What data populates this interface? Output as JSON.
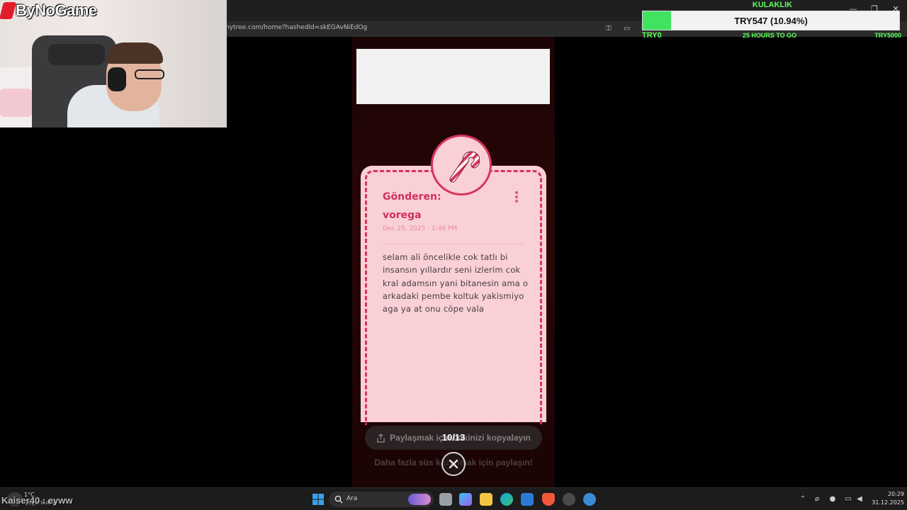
{
  "browser": {
    "url": "nytree.com/home?hashedId=skEGAvNiEdOg",
    "window_controls": [
      "minimize-icon",
      "restore-icon",
      "close-icon"
    ]
  },
  "stream": {
    "channel_logo": "ByNoGame",
    "goal": {
      "title": "KULAKLIK",
      "amount": "TRY547 (10.94%)",
      "progress_fraction": 0.1094,
      "start_label": "TRY0",
      "time_left": "25 HOURS TO GO",
      "target_label": "TRY5000",
      "fill_color": "#3fe35f"
    },
    "chat_overlay": "Kaiser40 : eyww"
  },
  "card": {
    "sender_label": "Gönderen:",
    "sender_name": "vorega",
    "date": "Dec 25, 2025 · 1:46 PM",
    "message": "selam ali öncelikle cok tatlı bi insansın yıllardır seni izlerim cok kral adamsın yani bitanesin ama o arkadaki pembe koltuk yakismiyo aga ya at onu cöpe vala",
    "badge_icon": "candy-cane-icon",
    "accent_color": "#d8355a",
    "background_color": "#f8d0d6"
  },
  "share": {
    "button_label": "Paylaşmak için linkinizi kopyalayın",
    "counter": "10/13",
    "more_text": "Daha fazla süs kazanmak için paylaşın!"
  },
  "taskbar": {
    "weather_temp": "1°C",
    "weather_desc": "Çoğunlukla",
    "search_placeholder": "Ara",
    "time": "20:29",
    "date": "31.12.2025"
  }
}
